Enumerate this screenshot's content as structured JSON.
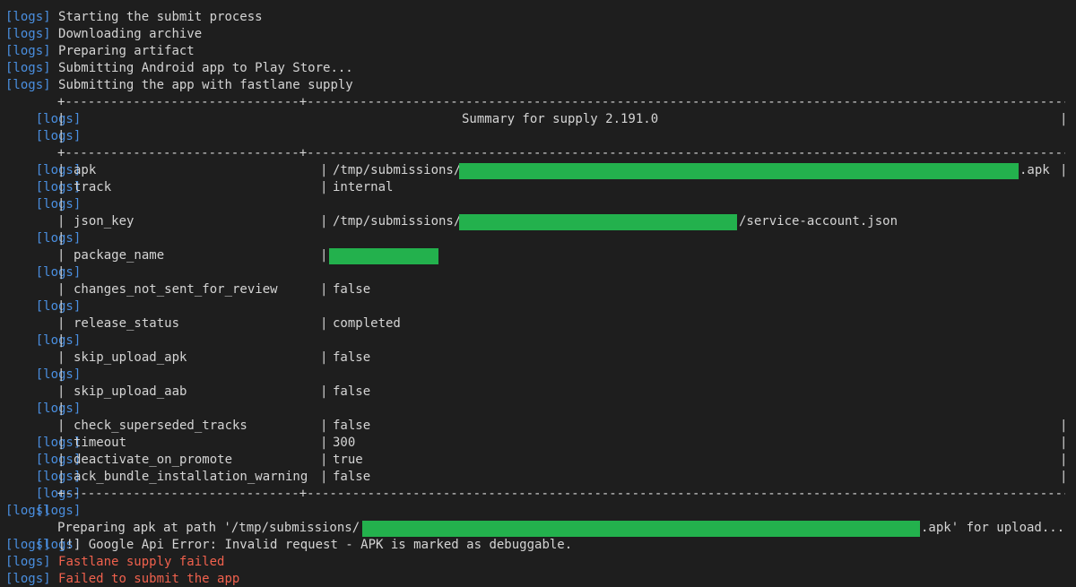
{
  "terminal": {
    "prefix": "[logs]",
    "intro": [
      "Starting the submit process",
      "Downloading archive",
      "Preparing artifact",
      "Submitting Android app to Play Store...",
      "Submitting the app with fastlane supply"
    ],
    "table": {
      "border_left": "+-------------------------------+",
      "border_right": "---------------------------------------------------------------------------------------+",
      "title": "Summary for supply 2.191.0",
      "rows": [
        {
          "key": "apk",
          "value": "/tmp/submissions/",
          "suffix": ".apk"
        },
        {
          "key": "track",
          "value": "internal"
        },
        {
          "key": "json_key",
          "value": "/tmp/submissions/",
          "suffix": "/service-account.json"
        },
        {
          "key": "package_name",
          "value": ""
        },
        {
          "key": "changes_not_sent_for_review",
          "value": "false"
        },
        {
          "key": "release_status",
          "value": "completed"
        },
        {
          "key": "skip_upload_apk",
          "value": "false"
        },
        {
          "key": "skip_upload_aab",
          "value": "false"
        },
        {
          "key": "check_superseded_tracks",
          "value": "false"
        },
        {
          "key": "timeout",
          "value": "300"
        },
        {
          "key": "deactivate_on_promote",
          "value": "true"
        },
        {
          "key": "ack_bundle_installation_warning",
          "value": "false"
        }
      ]
    },
    "preparing": {
      "before": "Preparing apk at path '/tmp/submissions/",
      "after": ".apk' for upload..."
    },
    "api_error": "[!] Google Api Error: Invalid request - APK is marked as debuggable.",
    "errors": [
      "Fastlane supply failed",
      "Failed to submit the app"
    ],
    "colors": {
      "background": "#1e1e1e",
      "tag": "#4a8fe0",
      "text": "#d4d4d4",
      "error": "#f0614d",
      "redaction": "#23b14d"
    }
  }
}
